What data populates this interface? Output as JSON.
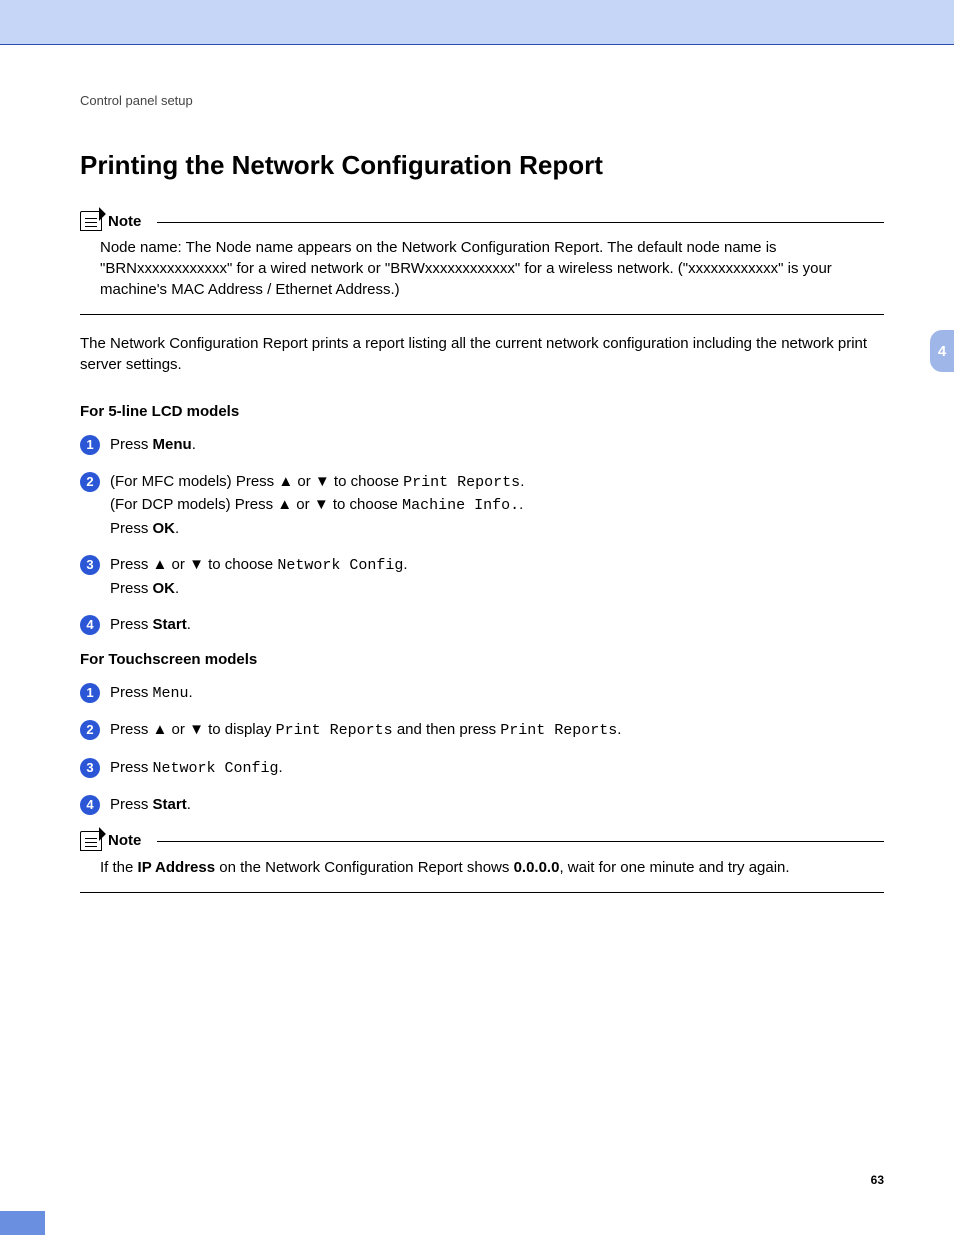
{
  "breadcrumb": "Control panel setup",
  "title": "Printing the Network Configuration Report",
  "note1": {
    "label": "Note",
    "body": "Node name: The Node name appears on the Network Configuration Report. The default node name is \"BRNxxxxxxxxxxxx\" for a wired network or \"BRWxxxxxxxxxxxx\" for a wireless network. (\"xxxxxxxxxxxx\" is your machine's MAC Address / Ethernet Address.)"
  },
  "intro": "The Network Configuration Report prints a report listing all the current network configuration including the network print server settings.",
  "section_lcd": "For 5-line LCD models",
  "lcd_steps": {
    "s1_pre": "Press ",
    "s1_b": "Menu",
    "s1_post": ".",
    "s2_l1a": "(For MFC models) Press ",
    "s2_l1b": " or ",
    "s2_l1c": " to choose ",
    "s2_l1_mono": "Print Reports",
    "s2_l1d": ".",
    "s2_l2a": "(For DCP models) Press ",
    "s2_l2b": " or ",
    "s2_l2c": " to choose ",
    "s2_l2_mono": "Machine Info.",
    "s2_l2d": ".",
    "s2_l3a": "Press ",
    "s2_l3_b": "OK",
    "s2_l3c": ".",
    "s3_l1a": "Press ",
    "s3_l1b": " or ",
    "s3_l1c": " to choose ",
    "s3_l1_mono": "Network Config",
    "s3_l1d": ".",
    "s3_l2a": "Press ",
    "s3_l2_b": "OK",
    "s3_l2c": ".",
    "s4_pre": "Press ",
    "s4_b": "Start",
    "s4_post": "."
  },
  "section_touch": "For Touchscreen models",
  "touch_steps": {
    "s1_pre": "Press ",
    "s1_mono": "Menu",
    "s1_post": ".",
    "s2_a": "Press ",
    "s2_b": " or ",
    "s2_c": " to display ",
    "s2_mono1": "Print Reports",
    "s2_d": " and then press ",
    "s2_mono2": "Print Reports",
    "s2_e": ".",
    "s3_a": "Press ",
    "s3_mono": "Network Config",
    "s3_b": ".",
    "s4_pre": "Press ",
    "s4_b": "Start",
    "s4_post": "."
  },
  "note2": {
    "label": "Note",
    "pre": "If the ",
    "b1": "IP Address",
    "mid": " on the Network Configuration Report shows ",
    "b2": "0.0.0.0",
    "post": ", wait for one minute and try again."
  },
  "arrows": {
    "up": "▲",
    "down": "▼"
  },
  "tab": "4",
  "page": "63"
}
